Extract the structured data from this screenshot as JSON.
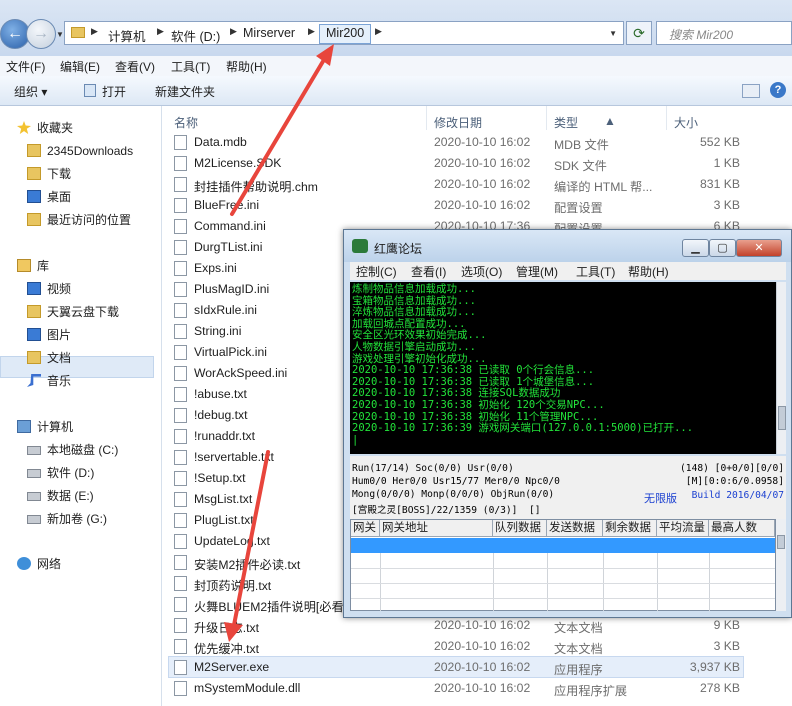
{
  "explorer": {
    "search_placeholder": "搜索 Mir200",
    "breadcrumb": [
      "计算机",
      "软件 (D:)",
      "Mirserver",
      "Mir200"
    ],
    "menu": [
      "文件(F)",
      "编辑(E)",
      "查看(V)",
      "工具(T)",
      "帮助(H)"
    ],
    "toolbar": [
      "组织 ▾",
      "打开",
      "新建文件夹"
    ],
    "nav": {
      "favorites": "收藏夹",
      "favorite_items": [
        "2345Downloads",
        "下载",
        "桌面",
        "最近访问的位置"
      ],
      "library": "库",
      "library_items": [
        "视频",
        "天翼云盘下载",
        "图片",
        "文档",
        "音乐"
      ],
      "computer": "计算机",
      "computer_items": [
        "本地磁盘 (C:)",
        "软件 (D:)",
        "数据 (E:)",
        "新加卷 (G:)"
      ],
      "network": "网络"
    },
    "columns": [
      "名称",
      "修改日期",
      "类型",
      "大小"
    ],
    "files": [
      {
        "name": "Data.mdb",
        "date": "2020-10-10 16:02",
        "type": "MDB 文件",
        "size": "552 KB"
      },
      {
        "name": "M2License.SDK",
        "date": "2020-10-10 16:02",
        "type": "SDK 文件",
        "size": "1 KB"
      },
      {
        "name": "封挂插件帮助说明.chm",
        "date": "2020-10-10 16:02",
        "type": "编译的 HTML 帮...",
        "size": "831 KB"
      },
      {
        "name": "BlueFree.ini",
        "date": "2020-10-10 16:02",
        "type": "配置设置",
        "size": "3 KB"
      },
      {
        "name": "Command.ini",
        "date": "2020-10-10 17:36",
        "type": "配置设置",
        "size": "6 KB"
      },
      {
        "name": "DurgTList.ini",
        "date": "",
        "type": "",
        "size": ""
      },
      {
        "name": "Exps.ini",
        "date": "",
        "type": "",
        "size": ""
      },
      {
        "name": "PlusMagID.ini",
        "date": "",
        "type": "",
        "size": ""
      },
      {
        "name": "sIdxRule.ini",
        "date": "",
        "type": "",
        "size": ""
      },
      {
        "name": "String.ini",
        "date": "",
        "type": "",
        "size": ""
      },
      {
        "name": "VirtualPick.ini",
        "date": "",
        "type": "",
        "size": ""
      },
      {
        "name": "WorAckSpeed.ini",
        "date": "",
        "type": "",
        "size": ""
      },
      {
        "name": "!abuse.txt",
        "date": "",
        "type": "",
        "size": ""
      },
      {
        "name": "!debug.txt",
        "date": "",
        "type": "",
        "size": ""
      },
      {
        "name": "!runaddr.txt",
        "date": "",
        "type": "",
        "size": ""
      },
      {
        "name": "!servertable.txt",
        "date": "",
        "type": "",
        "size": ""
      },
      {
        "name": "!Setup.txt",
        "date": "",
        "type": "",
        "size": ""
      },
      {
        "name": "MsgList.txt",
        "date": "",
        "type": "",
        "size": ""
      },
      {
        "name": "PlugList.txt",
        "date": "",
        "type": "",
        "size": ""
      },
      {
        "name": "UpdateLog.txt",
        "date": "",
        "type": "",
        "size": ""
      },
      {
        "name": "安装M2插件必读.txt",
        "date": "",
        "type": "",
        "size": ""
      },
      {
        "name": "封顶药说明.txt",
        "date": "",
        "type": "",
        "size": ""
      },
      {
        "name": "火舞BLUEM2插件说明[必看",
        "date": "",
        "type": "",
        "size": ""
      },
      {
        "name": "升级日志.txt",
        "date": "2020-10-10 16:02",
        "type": "文本文档",
        "size": "9 KB"
      },
      {
        "name": "优先缓冲.txt",
        "date": "2020-10-10 16:02",
        "type": "文本文档",
        "size": "3 KB"
      },
      {
        "name": "M2Server.exe",
        "date": "2020-10-10 16:02",
        "type": "应用程序",
        "size": "3,937 KB"
      },
      {
        "name": "mSystemModule.dll",
        "date": "2020-10-10 16:02",
        "type": "应用程序扩展",
        "size": "278 KB"
      }
    ]
  },
  "server_window": {
    "title": "红鹰论坛",
    "menu": [
      "控制(C)",
      "查看(I)",
      "选项(O)",
      "管理(M)",
      "工具(T)",
      "帮助(H)"
    ],
    "log": [
      "炼制物品信息加载成功...",
      "宝箱物品信息加载成功...",
      "淬炼物品信息加载成功...",
      "加载回城点配置成功...",
      "安全区光环效果初始完成...",
      "人物数据引擎启动成功...",
      "游戏处理引擎初始化成功...",
      "2020-10-10 17:36:38 已读取 0个行会信息...",
      "2020-10-10 17:36:38 已读取 1个城堡信息...",
      "2020-10-10 17:36:38 连接SQL数据成功",
      "2020-10-10 17:36:38 初始化 120个交易NPC...",
      "2020-10-10 17:36:38 初始化 11个管理NPC...",
      "2020-10-10 17:36:39 游戏网关端口(127.0.0.1:5000)已打开...",
      "|"
    ],
    "status": {
      "l1": "Run(17/14) Soc(0/0) Usr(0/0)",
      "r1": "(148) [0+0/0][0/0]",
      "l2": "Hum0/0 Her0/0 Usr15/77 Mer0/0 Npc0/0",
      "r2": "[M][0:0:6/0.0958]",
      "l3": "Mong(0/0/0) Monp(0/0/0) ObjRun(0/0)",
      "edition": "无限版",
      "build": "Build 2016/04/07",
      "l4": "[宫殿之灵[BOSS]/22/1359 (0/3)]  []"
    },
    "grid_columns": [
      "网关",
      "网关地址",
      "队列数据",
      "发送数据",
      "剩余数据",
      "平均流量",
      "最高人数"
    ]
  },
  "colors": {
    "accent": "#3399ff",
    "console_text": "#22e33a",
    "arrow": "#e8453c",
    "edition": "#1a3fd0"
  }
}
